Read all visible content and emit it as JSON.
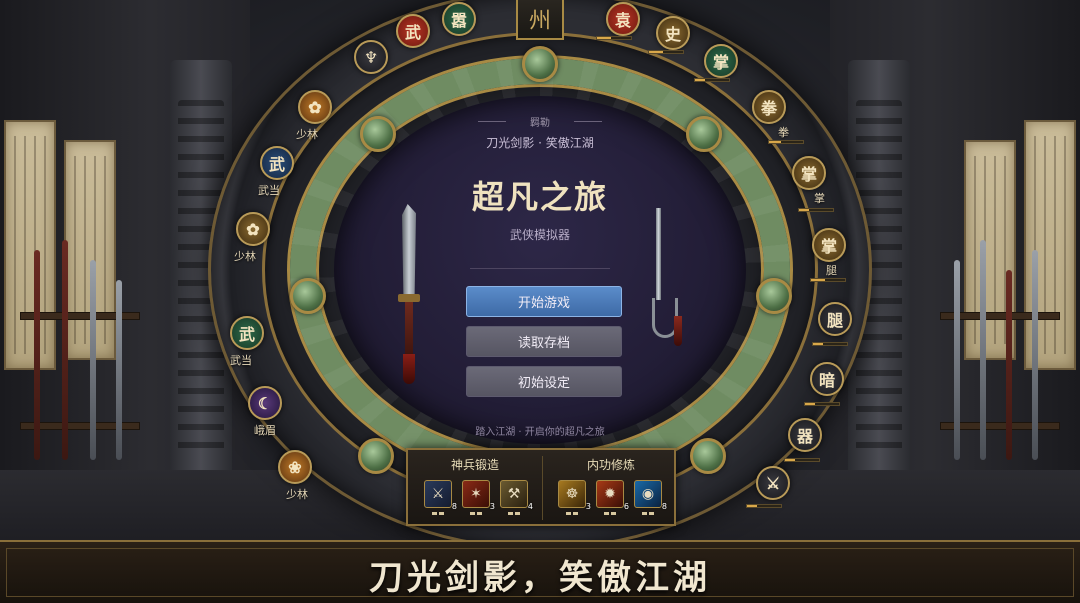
{
  "banner": {
    "text": "刀光剑影，笑傲江湖"
  },
  "main_menu": {
    "top_label": "羁勒",
    "tagline": "刀光剑影 · 笑傲江湖",
    "title": "超凡之旅",
    "subtitle": "武侠模拟器",
    "buttons": [
      {
        "label": "开始游戏",
        "primary": true
      },
      {
        "label": "读取存档",
        "primary": false
      },
      {
        "label": "初始设定",
        "primary": false
      }
    ],
    "footer": "踏入江湖 · 开启你的超凡之旅"
  },
  "top_crest": {
    "glyph": "州"
  },
  "top_emblems": [
    {
      "glyph": "武",
      "color": "red"
    },
    {
      "glyph": "嚣",
      "color": "green"
    },
    {
      "glyph": "袁",
      "color": "red"
    },
    {
      "glyph": "史",
      "color": "gold"
    },
    {
      "glyph": "掌",
      "color": "green"
    }
  ],
  "left_emblems": [
    {
      "icon": "lotus-icon",
      "glyph": "✿",
      "color": "orange",
      "label": "少林"
    },
    {
      "icon": "wudang-icon",
      "glyph": "武",
      "color": "blue",
      "label": "武当"
    },
    {
      "icon": "lotus-icon",
      "glyph": "✿",
      "color": "gold",
      "label": "少林"
    },
    {
      "icon": "wudang-icon",
      "glyph": "武",
      "color": "green",
      "label": "武当"
    },
    {
      "icon": "moon-icon",
      "glyph": "☾",
      "color": "purple",
      "label": "峨眉"
    },
    {
      "icon": "paw-icon",
      "glyph": "❀",
      "color": "orange",
      "label": "少林"
    }
  ],
  "right_emblems": [
    {
      "glyph": "拳",
      "label": "拳",
      "progress": 0.35
    },
    {
      "glyph": "掌",
      "label": "掌",
      "progress": 0.3
    },
    {
      "glyph": "掌",
      "label": "腿",
      "progress": 0.4
    },
    {
      "glyph": "腿",
      "label": "",
      "progress": 0.3
    },
    {
      "glyph": "暗",
      "label": "",
      "progress": 0.3
    },
    {
      "glyph": "器",
      "label": "",
      "progress": 0.3
    }
  ],
  "skills": {
    "forge": {
      "title": "神兵锻造",
      "slots": [
        {
          "icon": "sword-icon",
          "glyph": "⚔",
          "count": "8"
        },
        {
          "icon": "flame-blade-icon",
          "glyph": "✶",
          "count": "3"
        },
        {
          "icon": "axe-icon",
          "glyph": "⚒",
          "count": "4"
        }
      ]
    },
    "inner": {
      "title": "内功修炼",
      "slots": [
        {
          "icon": "meditation-icon",
          "glyph": "☸",
          "count": "3"
        },
        {
          "icon": "fire-body-icon",
          "glyph": "✹",
          "count": "6"
        },
        {
          "icon": "aura-icon",
          "glyph": "◉",
          "count": "8"
        }
      ]
    }
  },
  "colors": {
    "accent": "#a88a44",
    "primary_button": "#4e7dbb",
    "jade": "#6f8c62"
  }
}
